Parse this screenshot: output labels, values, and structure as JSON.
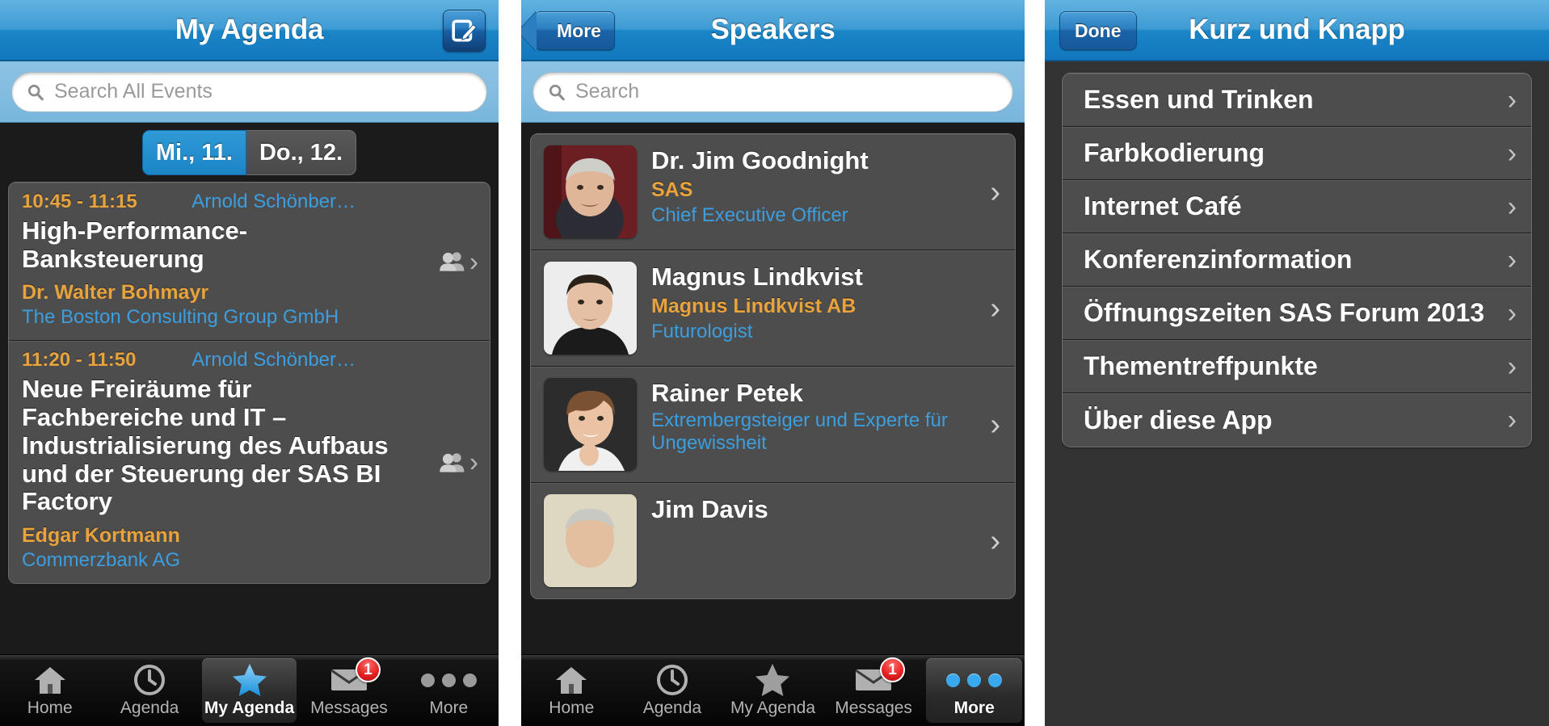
{
  "colors": {
    "accent_blue": "#1a85c6",
    "link_blue": "#3c9ede",
    "orange": "#e8a33d",
    "card_gray": "#4d4d4d",
    "badge_red": "#e02020"
  },
  "panel1": {
    "nav": {
      "title": "My Agenda",
      "right_icon": "compose-icon"
    },
    "search": {
      "placeholder": "Search All Events",
      "value": "",
      "icon": "search-icon"
    },
    "date_tabs": [
      {
        "label": "Mi., 11.",
        "selected": true
      },
      {
        "label": "Do., 12.",
        "selected": false
      }
    ],
    "events": [
      {
        "time": "10:45 - 11:15",
        "room": "Arnold Schönber…",
        "title": "High-Performance-Banksteuerung",
        "speaker": "Dr. Walter Bohmayr",
        "org": "The Boston Consulting Group GmbH",
        "accessory_icon": "people-icon",
        "chevron": "›"
      },
      {
        "time": "11:20 - 11:50",
        "room": "Arnold Schönber…",
        "title": "Neue Freiräume für Fachbereiche und IT – Industrialisierung des Aufbaus und der Steuerung der SAS BI Factory",
        "speaker": "Edgar Kortmann",
        "org": "Commerzbank AG",
        "accessory_icon": "people-icon",
        "chevron": "›"
      }
    ],
    "tabs": [
      {
        "label": "Home",
        "icon": "home-icon",
        "selected": false,
        "badge": ""
      },
      {
        "label": "Agenda",
        "icon": "clock-icon",
        "selected": false,
        "badge": ""
      },
      {
        "label": "My Agenda",
        "icon": "star-icon",
        "selected": true,
        "badge": ""
      },
      {
        "label": "Messages",
        "icon": "envelope-icon",
        "selected": false,
        "badge": "1"
      },
      {
        "label": "More",
        "icon": "ellipsis-icon",
        "selected": false,
        "badge": ""
      }
    ]
  },
  "panel2": {
    "nav": {
      "back_label": "More",
      "title": "Speakers"
    },
    "search": {
      "placeholder": "Search",
      "value": "",
      "icon": "search-icon"
    },
    "speakers": [
      {
        "name": "Dr. Jim Goodnight",
        "org": "SAS",
        "role": "Chief Executive Officer",
        "chevron": "›"
      },
      {
        "name": "Magnus Lindkvist",
        "org": "Magnus Lindkvist AB",
        "role": "Futurologist",
        "chevron": "›"
      },
      {
        "name": "Rainer Petek",
        "org": "",
        "role": "Extrembergsteiger und Experte für Ungewissheit",
        "chevron": "›"
      },
      {
        "name": "Jim Davis",
        "org": "",
        "role": "",
        "chevron": "›"
      }
    ],
    "tabs": [
      {
        "label": "Home",
        "icon": "home-icon",
        "selected": false,
        "badge": ""
      },
      {
        "label": "Agenda",
        "icon": "clock-icon",
        "selected": false,
        "badge": ""
      },
      {
        "label": "My Agenda",
        "icon": "star-icon",
        "selected": false,
        "badge": ""
      },
      {
        "label": "Messages",
        "icon": "envelope-icon",
        "selected": false,
        "badge": "1"
      },
      {
        "label": "More",
        "icon": "ellipsis-icon",
        "selected": true,
        "badge": ""
      }
    ]
  },
  "panel3": {
    "nav": {
      "done_label": "Done",
      "title": "Kurz und Knapp"
    },
    "menu": [
      {
        "label": "Essen und Trinken",
        "chevron": "›"
      },
      {
        "label": "Farbkodierung",
        "chevron": "›"
      },
      {
        "label": "Internet Café",
        "chevron": "›"
      },
      {
        "label": "Konferenzinformation",
        "chevron": "›"
      },
      {
        "label": "Öffnungszeiten SAS Forum 2013",
        "chevron": "›"
      },
      {
        "label": "Thementreffpunkte",
        "chevron": "›"
      },
      {
        "label": "Über diese App",
        "chevron": "›"
      }
    ]
  }
}
